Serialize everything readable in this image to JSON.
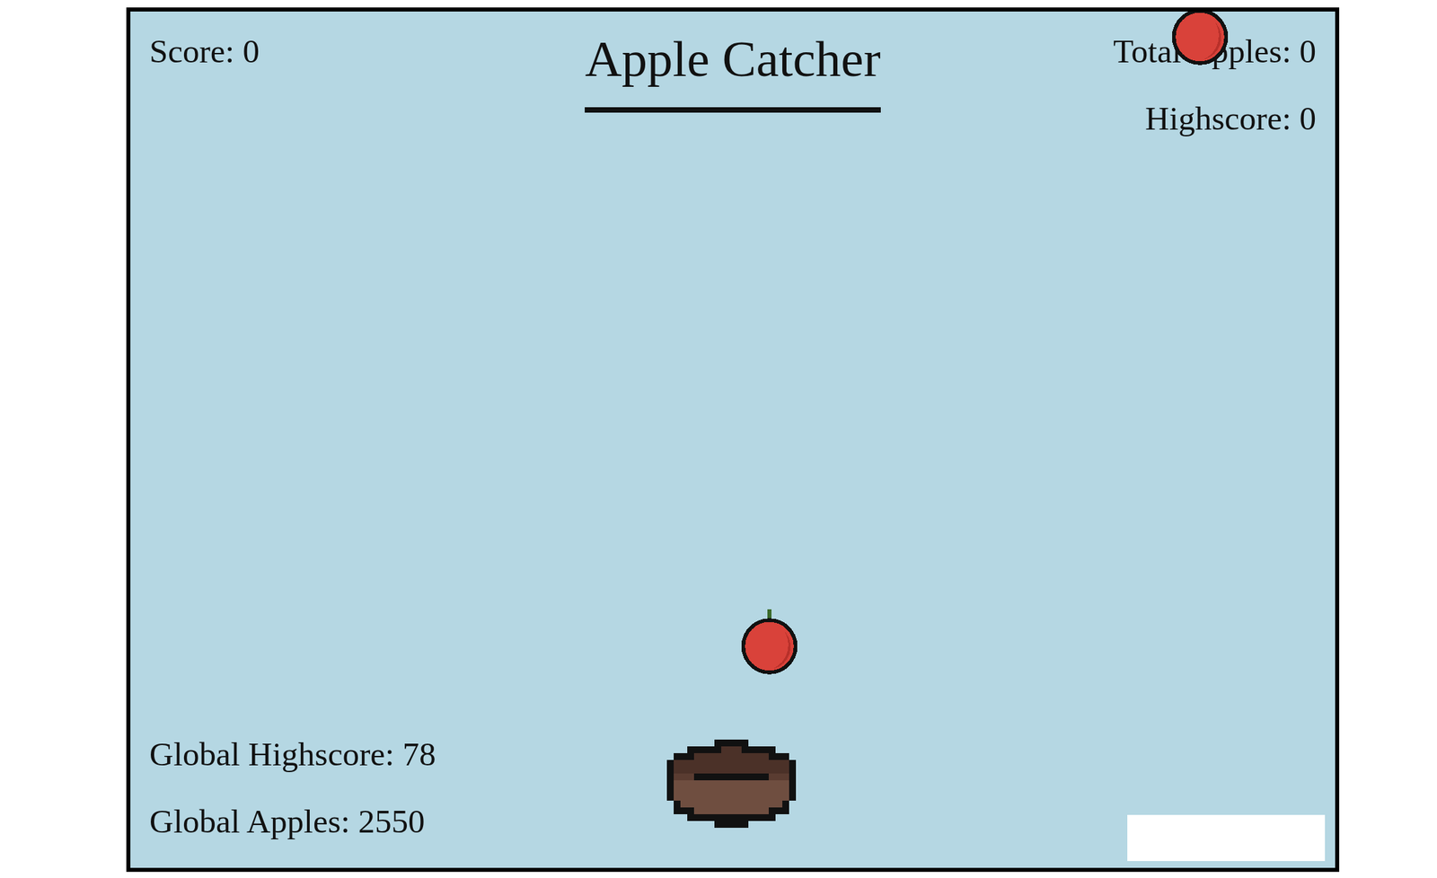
{
  "game": {
    "title": "Apple Catcher"
  },
  "stats": {
    "score": "Score: 0",
    "total_apples": "Total Apples: 0",
    "highscore": "Highscore: 0"
  },
  "global": {
    "highscore": "Global Highscore: 78",
    "apples": "Global Apples: 2550"
  },
  "name_input": {
    "value": ""
  }
}
